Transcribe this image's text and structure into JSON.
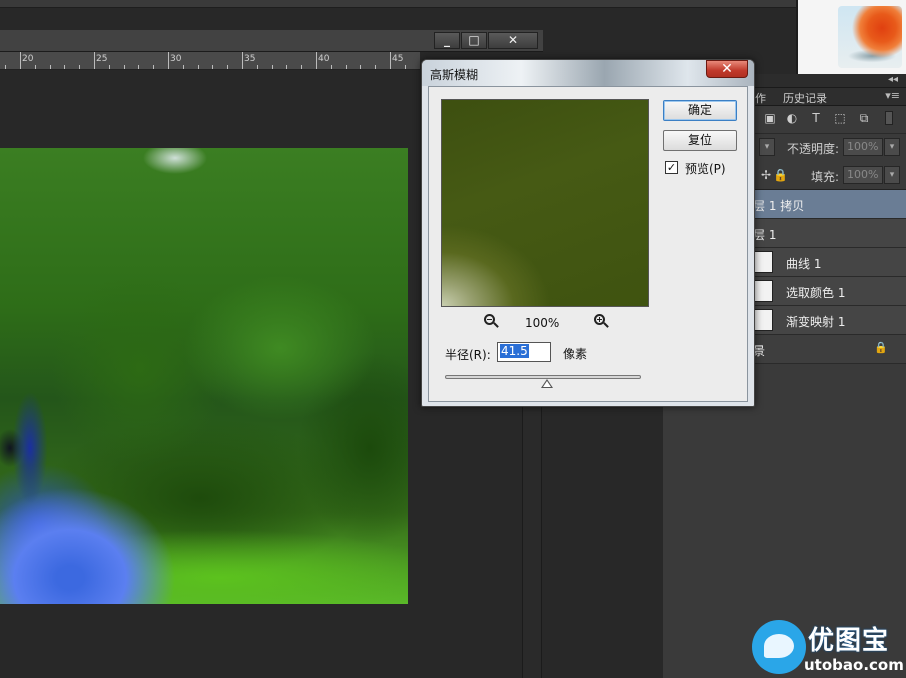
{
  "ruler": {
    "ticks": [
      "20",
      "25",
      "30",
      "35",
      "40",
      "45"
    ]
  },
  "doc_controls": {
    "minimize": "_",
    "maximize": "□",
    "close": "✕"
  },
  "panel": {
    "collapse_glyph": "◂◂",
    "tabs": [
      "作",
      "历史记录"
    ],
    "menu_glyph": "▾≡",
    "opacity_label": "不透明度:",
    "opacity_value": "100%",
    "fill_label": "填充:",
    "fill_value": "100%",
    "layers": [
      {
        "name": "层 1 拷贝",
        "selected": true
      },
      {
        "name": "层 1",
        "selected": false
      },
      {
        "name": "曲线 1",
        "selected": false
      },
      {
        "name": "选取颜色 1",
        "selected": false
      },
      {
        "name": "渐变映射 1",
        "selected": false
      },
      {
        "name": "景",
        "selected": false
      }
    ]
  },
  "dialog": {
    "title": "高斯模糊",
    "close": "✕",
    "ok_label": "确定",
    "reset_label": "复位",
    "preview_label": "预览(P)",
    "preview_checked": "✓",
    "zoom_level": "100%",
    "radius_label": "半径(R):",
    "radius_value": "41.5",
    "radius_unit": "像素",
    "slider_fraction": 0.52
  },
  "watermark": {
    "text": "优图宝",
    "url": "utobao.com"
  }
}
